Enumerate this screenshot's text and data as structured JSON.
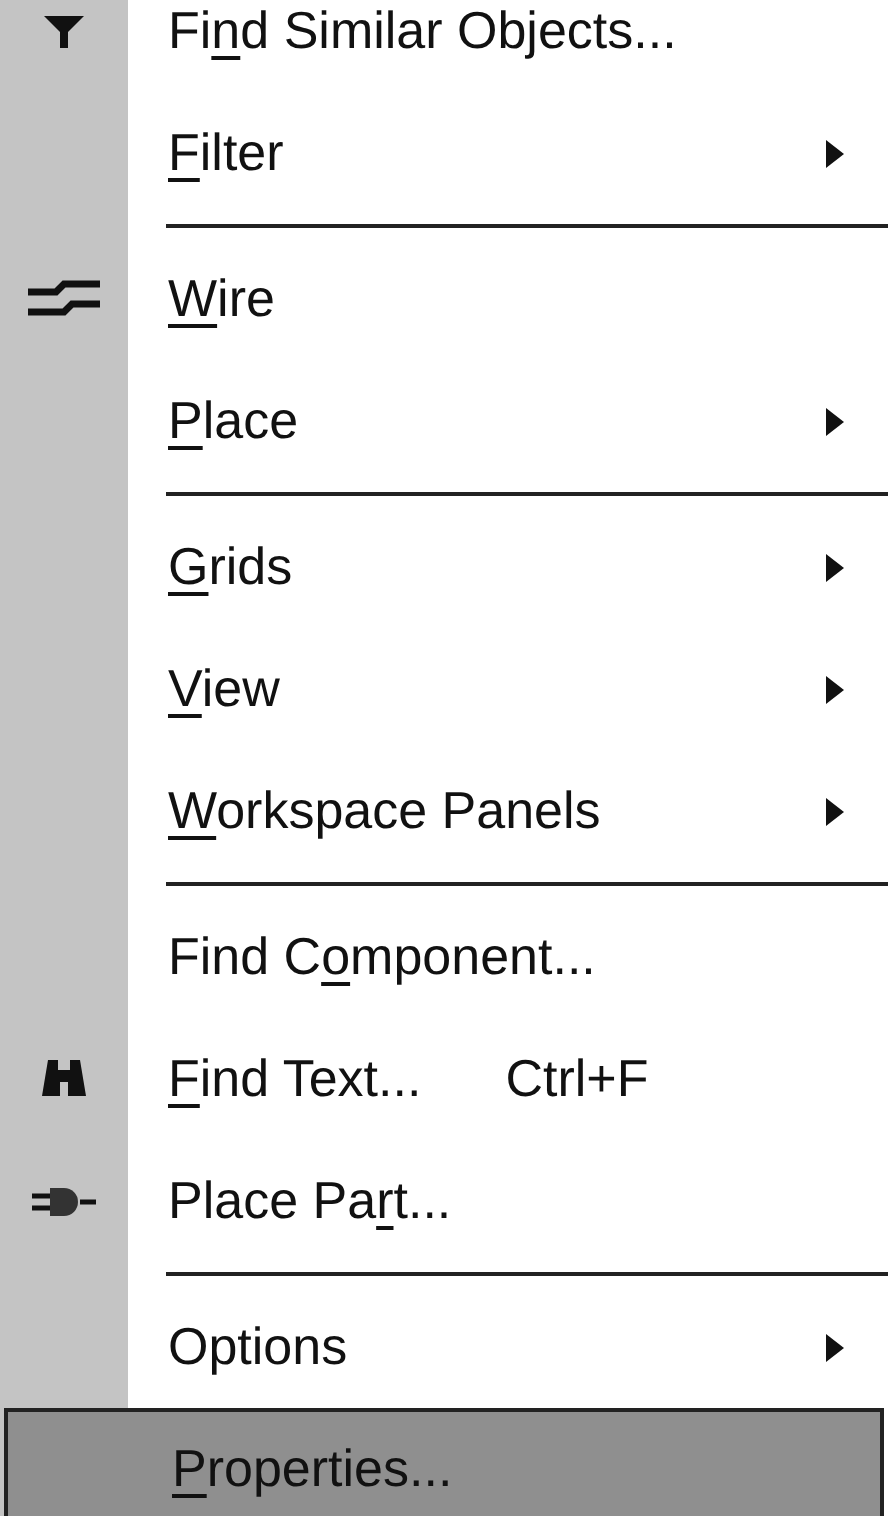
{
  "menu": {
    "items": [
      {
        "kind": "item",
        "label": [
          {
            "text": "Fi",
            "underlined": false
          },
          {
            "text": "n",
            "underlined": true
          },
          {
            "text": "d Similar Objects...",
            "underlined": false
          }
        ],
        "submenu": false,
        "selected": false
      },
      {
        "kind": "item",
        "label": [
          {
            "text": "F",
            "underlined": true
          },
          {
            "text": "ilter",
            "underlined": false
          }
        ],
        "submenu": true,
        "selected": false
      },
      {
        "kind": "separator"
      },
      {
        "kind": "item",
        "label": [
          {
            "text": "W",
            "underlined": true
          },
          {
            "text": "ire",
            "underlined": false
          }
        ],
        "submenu": false,
        "selected": false
      },
      {
        "kind": "item",
        "label": [
          {
            "text": "P",
            "underlined": true
          },
          {
            "text": "lace",
            "underlined": false
          }
        ],
        "submenu": true,
        "selected": false
      },
      {
        "kind": "separator"
      },
      {
        "kind": "item",
        "label": [
          {
            "text": "G",
            "underlined": true
          },
          {
            "text": "rids",
            "underlined": false
          }
        ],
        "submenu": true,
        "selected": false
      },
      {
        "kind": "item",
        "label": [
          {
            "text": "V",
            "underlined": true
          },
          {
            "text": "iew",
            "underlined": false
          }
        ],
        "submenu": true,
        "selected": false
      },
      {
        "kind": "item",
        "label": [
          {
            "text": "W",
            "underlined": true
          },
          {
            "text": "orkspace Panels",
            "underlined": false
          }
        ],
        "submenu": true,
        "selected": false
      },
      {
        "kind": "separator"
      },
      {
        "kind": "item",
        "label": [
          {
            "text": "Find C",
            "underlined": false
          },
          {
            "text": "o",
            "underlined": true
          },
          {
            "text": "mponent...",
            "underlined": false
          }
        ],
        "submenu": false,
        "selected": false
      },
      {
        "kind": "item",
        "label": [
          {
            "text": "F",
            "underlined": true
          },
          {
            "text": "ind Text...",
            "underlined": false
          }
        ],
        "shortcut": "Ctrl+F",
        "submenu": false,
        "selected": false
      },
      {
        "kind": "item",
        "label": [
          {
            "text": "Place Pa",
            "underlined": false
          },
          {
            "text": "r",
            "underlined": true
          },
          {
            "text": "t...",
            "underlined": false
          }
        ],
        "submenu": false,
        "selected": false
      },
      {
        "kind": "separator"
      },
      {
        "kind": "item",
        "label": [
          {
            "text": "Options",
            "underlined": false
          }
        ],
        "submenu": true,
        "selected": false
      },
      {
        "kind": "item",
        "label": [
          {
            "text": "P",
            "underlined": true
          },
          {
            "text": "roperties...",
            "underlined": false
          }
        ],
        "submenu": false,
        "selected": true
      }
    ]
  }
}
